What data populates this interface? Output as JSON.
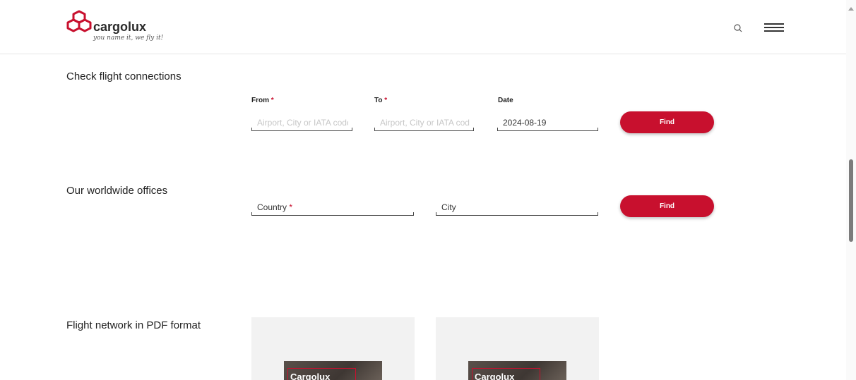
{
  "header": {
    "brand": "cargolux",
    "tagline": "you name it, we fly it!",
    "search_icon": "search-icon",
    "menu_icon": "hamburger-menu-icon"
  },
  "flight_connections": {
    "title": "Check flight connections",
    "from_label": "From",
    "to_label": "To",
    "date_label": "Date",
    "required_mark": "*",
    "from_placeholder": "Airport, City or IATA code",
    "to_placeholder": "Airport, City or IATA code",
    "date_value": "2024-08-19",
    "find_label": "Find"
  },
  "offices": {
    "title": "Our worldwide offices",
    "country_placeholder": "Country",
    "required_mark": "*",
    "city_placeholder": "City",
    "find_label": "Find"
  },
  "pdf": {
    "title": "Flight network in PDF format",
    "cards": [
      {
        "thumb_text": "Cargolux"
      },
      {
        "thumb_text": "Cargolux"
      }
    ]
  },
  "colors": {
    "accent": "#c8102e"
  }
}
